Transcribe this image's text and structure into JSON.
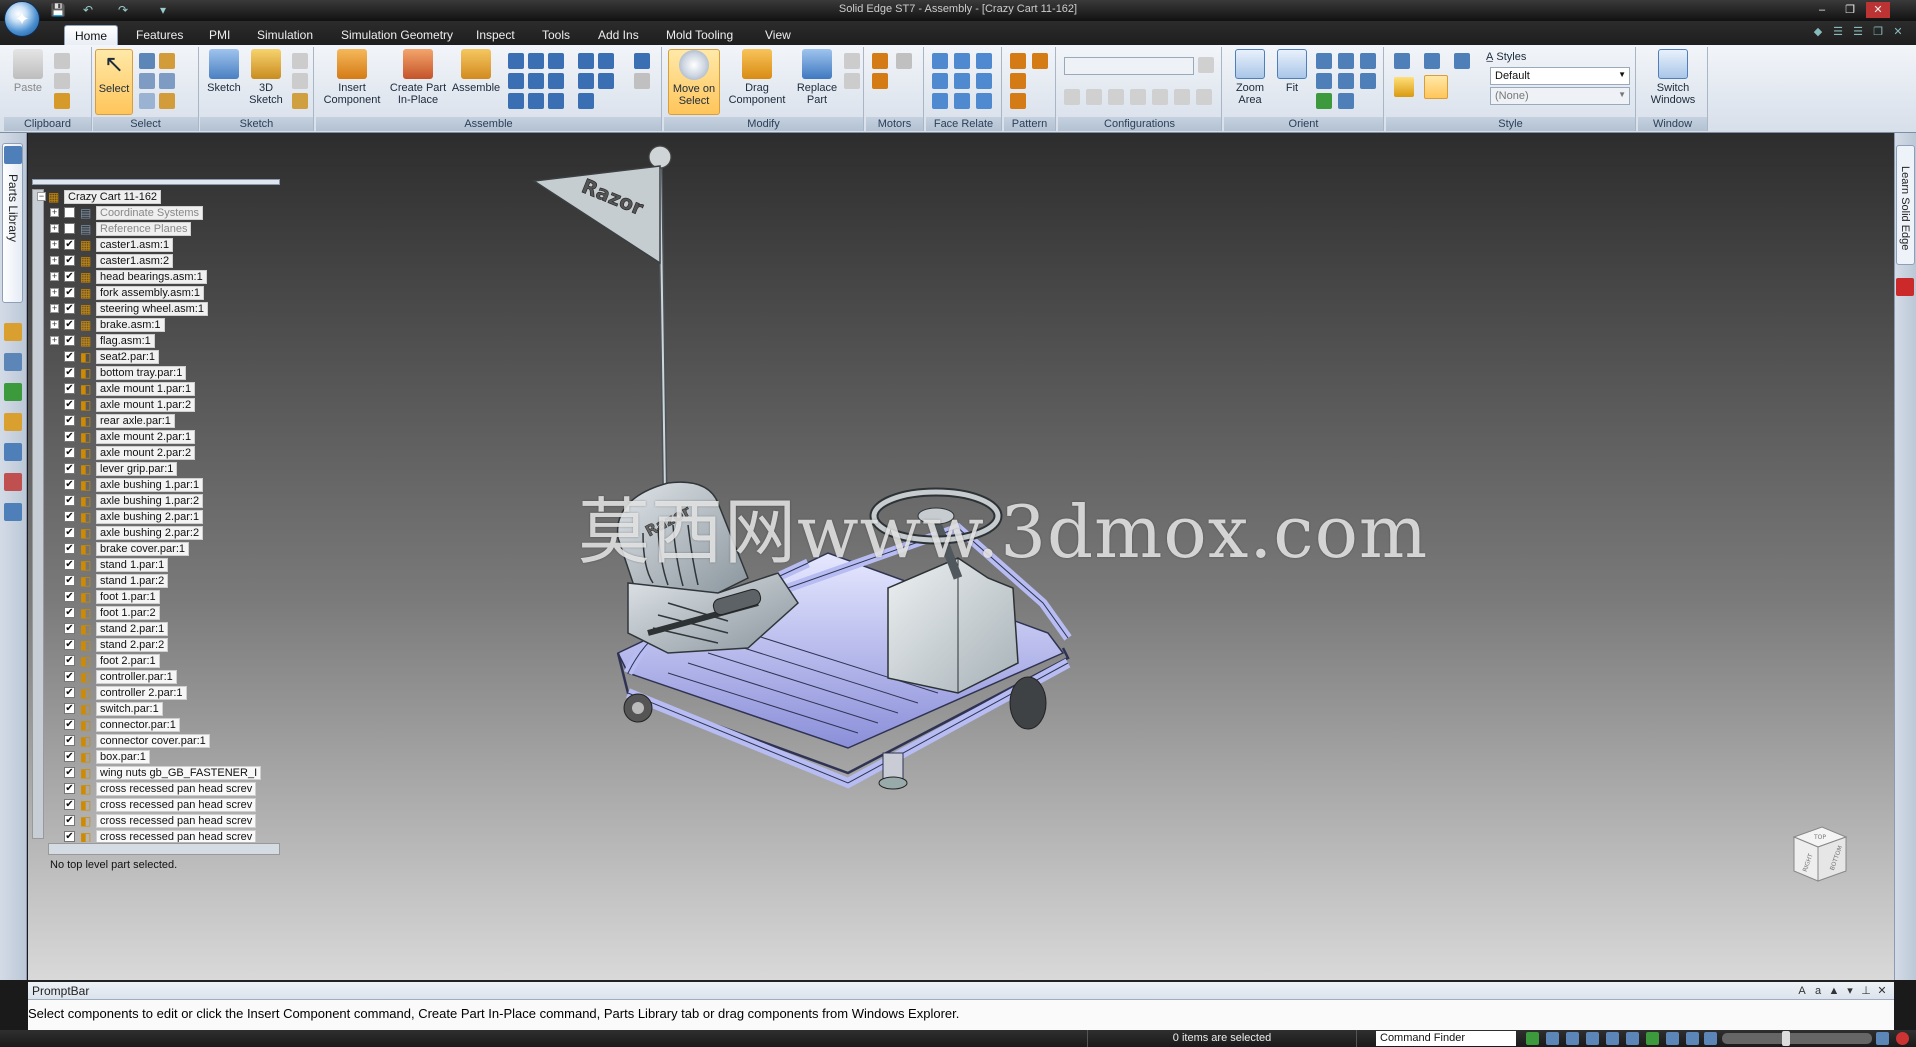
{
  "window": {
    "title": "Solid Edge ST7 - Assembly - [Crazy Cart 11-162]",
    "controls": [
      "–",
      "❐",
      "✕"
    ]
  },
  "quick_access": [
    "💾",
    "↶",
    "↷",
    "▾"
  ],
  "tabs": [
    "Home",
    "Features",
    "PMI",
    "Simulation",
    "Simulation Geometry",
    "Inspect",
    "Tools",
    "Add Ins",
    "Mold Tooling",
    "View"
  ],
  "ribbon": {
    "groups": [
      "Clipboard",
      "Select",
      "Sketch",
      "Assemble",
      "Modify",
      "Motors",
      "Face Relate",
      "Pattern",
      "Configurations",
      "Orient",
      "Style",
      "Window"
    ],
    "buttons": {
      "paste": "Paste",
      "select": "Select",
      "sketch": "Sketch",
      "sketch3d": "3D Sketch",
      "insert_component": "Insert Component",
      "create_part_in_place": "Create Part In-Place",
      "assemble": "Assemble",
      "move_on_select": "Move on Select",
      "drag_component": "Drag Component",
      "replace_part": "Replace Part",
      "zoom_area": "Zoom Area",
      "fit": "Fit",
      "switch_windows": "Switch Windows"
    },
    "style": {
      "styles_label": "Styles",
      "style_value": "Default",
      "secondary_value": "(None)"
    }
  },
  "side_tabs": {
    "parts_library": "Parts Library",
    "learn": "Learn Solid Edge"
  },
  "pathfinder": {
    "root": "Crazy Cart 11-162",
    "items": [
      {
        "label": "Coordinate Systems",
        "kind": "folder",
        "checked": false,
        "expandable": true,
        "dim": true
      },
      {
        "label": "Reference Planes",
        "kind": "folder",
        "checked": false,
        "expandable": true,
        "dim": true
      },
      {
        "label": "caster1.asm:1",
        "kind": "asm",
        "checked": true,
        "expandable": true
      },
      {
        "label": "caster1.asm:2",
        "kind": "asm",
        "checked": true,
        "expandable": true
      },
      {
        "label": "head bearings.asm:1",
        "kind": "asm",
        "checked": true,
        "expandable": true
      },
      {
        "label": "fork assembly.asm:1",
        "kind": "asm",
        "checked": true,
        "expandable": true
      },
      {
        "label": "steering wheel.asm:1",
        "kind": "asm",
        "checked": true,
        "expandable": true
      },
      {
        "label": "brake.asm:1",
        "kind": "asm",
        "checked": true,
        "expandable": true
      },
      {
        "label": "flag.asm:1",
        "kind": "asm",
        "checked": true,
        "expandable": true
      },
      {
        "label": "seat2.par:1",
        "kind": "par",
        "checked": true
      },
      {
        "label": "bottom tray.par:1",
        "kind": "par",
        "checked": true
      },
      {
        "label": "axle mount 1.par:1",
        "kind": "par",
        "checked": true
      },
      {
        "label": "axle mount 1.par:2",
        "kind": "par",
        "checked": true
      },
      {
        "label": "rear axle.par:1",
        "kind": "par",
        "checked": true
      },
      {
        "label": "axle mount 2.par:1",
        "kind": "par",
        "checked": true
      },
      {
        "label": "axle mount 2.par:2",
        "kind": "par",
        "checked": true
      },
      {
        "label": "lever grip.par:1",
        "kind": "par",
        "checked": true
      },
      {
        "label": "axle bushing 1.par:1",
        "kind": "par",
        "checked": true
      },
      {
        "label": "axle bushing 1.par:2",
        "kind": "par",
        "checked": true
      },
      {
        "label": "axle bushing 2.par:1",
        "kind": "par",
        "checked": true
      },
      {
        "label": "axle bushing 2.par:2",
        "kind": "par",
        "checked": true
      },
      {
        "label": "brake cover.par:1",
        "kind": "par",
        "checked": true
      },
      {
        "label": "stand 1.par:1",
        "kind": "par",
        "checked": true
      },
      {
        "label": "stand 1.par:2",
        "kind": "par",
        "checked": true
      },
      {
        "label": "foot 1.par:1",
        "kind": "par",
        "checked": true
      },
      {
        "label": "foot 1.par:2",
        "kind": "par",
        "checked": true
      },
      {
        "label": "stand 2.par:1",
        "kind": "par",
        "checked": true
      },
      {
        "label": "stand 2.par:2",
        "kind": "par",
        "checked": true
      },
      {
        "label": "foot 2.par:1",
        "kind": "par",
        "checked": true
      },
      {
        "label": "controller.par:1",
        "kind": "par",
        "checked": true
      },
      {
        "label": "controller 2.par:1",
        "kind": "par",
        "checked": true
      },
      {
        "label": "switch.par:1",
        "kind": "par",
        "checked": true
      },
      {
        "label": "connector.par:1",
        "kind": "par",
        "checked": true
      },
      {
        "label": "connector cover.par:1",
        "kind": "par",
        "checked": true
      },
      {
        "label": "box.par:1",
        "kind": "par",
        "checked": true
      },
      {
        "label": "wing nuts gb_GB_FASTENER_I",
        "kind": "par",
        "checked": true
      },
      {
        "label": "cross recessed pan head screv",
        "kind": "par",
        "checked": true
      },
      {
        "label": "cross recessed pan head screv",
        "kind": "par",
        "checked": true
      },
      {
        "label": "cross recessed pan head screv",
        "kind": "par",
        "checked": true
      },
      {
        "label": "cross recessed pan head screv",
        "kind": "par",
        "checked": true
      }
    ],
    "status": "No top level part selected."
  },
  "model": {
    "flag_text": "Razor",
    "seat_text": "Razor"
  },
  "watermark": "莫西网www.3dmox.com",
  "view_cube": {
    "top": "TOP",
    "right": "RIGHT",
    "front": "BOTTOM"
  },
  "promptbar": {
    "title": "PromptBar",
    "text": "Select components to edit or click the Insert Component command, Create Part In-Place command, Parts Library tab or drag components from Windows Explorer."
  },
  "statusbar": {
    "selected": "0 items are selected",
    "command_finder": "Command Finder"
  }
}
